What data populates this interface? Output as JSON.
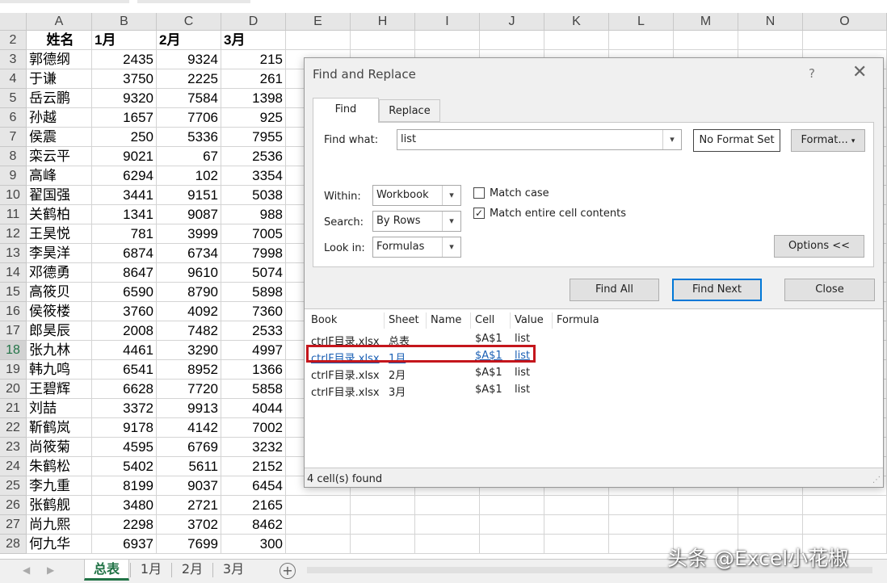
{
  "sheet": {
    "columns": [
      "A",
      "B",
      "C",
      "D",
      "E",
      "H",
      "I",
      "J",
      "K",
      "L",
      "M",
      "N",
      "O"
    ],
    "header_row": {
      "row": "2",
      "cells": [
        "姓名",
        "1月",
        "2月",
        "3月"
      ]
    },
    "rows": [
      {
        "row": "3",
        "name": "郭德纲",
        "v1": "2435",
        "v2": "9324",
        "v3": "215"
      },
      {
        "row": "4",
        "name": "于谦",
        "v1": "3750",
        "v2": "2225",
        "v3": "261"
      },
      {
        "row": "5",
        "name": "岳云鹏",
        "v1": "9320",
        "v2": "7584",
        "v3": "1398"
      },
      {
        "row": "6",
        "name": "孙越",
        "v1": "1657",
        "v2": "7706",
        "v3": "925"
      },
      {
        "row": "7",
        "name": "侯震",
        "v1": "250",
        "v2": "5336",
        "v3": "7955"
      },
      {
        "row": "8",
        "name": "栾云平",
        "v1": "9021",
        "v2": "67",
        "v3": "2536"
      },
      {
        "row": "9",
        "name": "高峰",
        "v1": "6294",
        "v2": "102",
        "v3": "3354"
      },
      {
        "row": "10",
        "name": "翟国强",
        "v1": "3441",
        "v2": "9151",
        "v3": "5038"
      },
      {
        "row": "11",
        "name": "关鹤柏",
        "v1": "1341",
        "v2": "9087",
        "v3": "988"
      },
      {
        "row": "12",
        "name": "王昊悦",
        "v1": "781",
        "v2": "3999",
        "v3": "7005"
      },
      {
        "row": "13",
        "name": "李昊洋",
        "v1": "6874",
        "v2": "6734",
        "v3": "7998"
      },
      {
        "row": "14",
        "name": "邓德勇",
        "v1": "8647",
        "v2": "9610",
        "v3": "5074"
      },
      {
        "row": "15",
        "name": "高筱贝",
        "v1": "6590",
        "v2": "8790",
        "v3": "5898"
      },
      {
        "row": "16",
        "name": "侯筱楼",
        "v1": "3760",
        "v2": "4092",
        "v3": "7360"
      },
      {
        "row": "17",
        "name": "郎昊辰",
        "v1": "2008",
        "v2": "7482",
        "v3": "2533"
      },
      {
        "row": "18",
        "name": "张九林",
        "v1": "4461",
        "v2": "3290",
        "v3": "4997"
      },
      {
        "row": "19",
        "name": "韩九鸣",
        "v1": "6541",
        "v2": "8952",
        "v3": "1366"
      },
      {
        "row": "20",
        "name": "王碧辉",
        "v1": "6628",
        "v2": "7720",
        "v3": "5858"
      },
      {
        "row": "21",
        "name": "刘喆",
        "v1": "3372",
        "v2": "9913",
        "v3": "4044"
      },
      {
        "row": "22",
        "name": "靳鹤岚",
        "v1": "9178",
        "v2": "4142",
        "v3": "7002"
      },
      {
        "row": "23",
        "name": "尚筱菊",
        "v1": "4595",
        "v2": "6769",
        "v3": "3232"
      },
      {
        "row": "24",
        "name": "朱鹤松",
        "v1": "5402",
        "v2": "5611",
        "v3": "2152"
      },
      {
        "row": "25",
        "name": "李九重",
        "v1": "8199",
        "v2": "9037",
        "v3": "6454"
      },
      {
        "row": "26",
        "name": "张鹤舰",
        "v1": "3480",
        "v2": "2721",
        "v3": "2165"
      },
      {
        "row": "27",
        "name": "尚九熙",
        "v1": "2298",
        "v2": "3702",
        "v3": "8462"
      },
      {
        "row": "28",
        "name": "何九华",
        "v1": "6937",
        "v2": "7699",
        "v3": "300"
      }
    ],
    "selected_row": "18"
  },
  "sheet_tabs": [
    "总表",
    "1月",
    "2月",
    "3月"
  ],
  "active_sheet_tab": "总表",
  "add_sheet_symbol": "+",
  "dialog": {
    "title": "Find and Replace",
    "help": "?",
    "close": "✕",
    "tabs": [
      "Find",
      "Replace"
    ],
    "find_what_label": "Find what:",
    "find_what_value": "list",
    "no_format_set": "No Format Set",
    "format_button": "Format...",
    "within_label": "Within:",
    "within_value": "Workbook",
    "search_label": "Search:",
    "search_value": "By Rows",
    "look_in_label": "Look in:",
    "look_in_value": "Formulas",
    "match_case_label": "Match case",
    "match_case_checked": false,
    "match_entire_label": "Match entire cell contents",
    "match_entire_checked": true,
    "options_button": "Options <<",
    "find_all_button": "Find All",
    "find_next_button": "Find Next",
    "close_button": "Close",
    "result_headers": [
      "Book",
      "Sheet",
      "Name",
      "Cell",
      "Value",
      "Formula"
    ],
    "results": [
      {
        "book": "ctrlF目录.xlsx",
        "sheet": "总表",
        "name": "",
        "cell": "$A$1",
        "value": "list",
        "formula": ""
      },
      {
        "book": "ctrlF目录.xlsx",
        "sheet": "1月",
        "name": "",
        "cell": "$A$1",
        "value": "list",
        "formula": ""
      },
      {
        "book": "ctrlF目录.xlsx",
        "sheet": "2月",
        "name": "",
        "cell": "$A$1",
        "value": "list",
        "formula": ""
      },
      {
        "book": "ctrlF目录.xlsx",
        "sheet": "3月",
        "name": "",
        "cell": "$A$1",
        "value": "list",
        "formula": ""
      }
    ],
    "highlighted_result": 1,
    "status": "4 cell(s) found"
  },
  "watermark": "头条 @Excel小花椒",
  "colors": {
    "excel_green": "#217346",
    "highlight_red": "#c4161c",
    "link_blue": "#1a5fb4"
  }
}
